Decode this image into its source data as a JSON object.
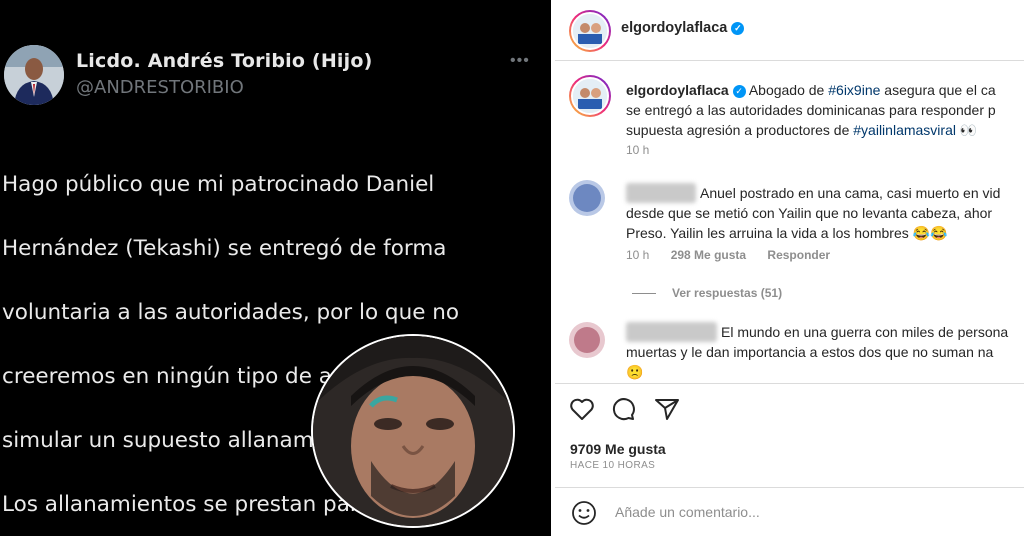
{
  "tweet": {
    "name": "Licdo. Andrés Toribio (Hijo)",
    "handle": "@ANDRESTORIBIO",
    "more_label": "•••",
    "text_lines": [
      "Hago público que mi patrocinado Daniel",
      "Hernández (Tekashi) se entregó de forma",
      "voluntaria a las autoridades, por lo que no",
      "creeremos en ningún tipo de actuación ilícita,",
      "simular un supuesto allanamiento no es bueno.",
      "Los allanamientos se prestan para mucho…"
    ]
  },
  "instagram": {
    "username": "elgordoylaflaca",
    "caption": {
      "username": "elgordoylaflaca",
      "part1": "Abogado de",
      "tag1": "#6ix9ine",
      "part2": "asegura que el ca",
      "line2": "se entregó a las autoridades dominicanas para responder p",
      "line3_prefix": "supuesta agresión a productores de",
      "tag2": "#yailinlamasviral",
      "emoji": "👀",
      "time": "10 h"
    },
    "comments": [
      {
        "lines": [
          "Anuel postrado en una cama, casi muerto en vid",
          "desde que se metió con Yailin que no levanta cabeza, ahor",
          "Preso. Yailin les arruina la vida a los hombres 😂😂"
        ],
        "time": "10 h",
        "likes": "298 Me gusta",
        "reply_label": "Responder",
        "replies_label": "Ver respuestas (51)"
      },
      {
        "lines": [
          "El mundo en una guerra con miles de persona",
          "muertas y le dan importancia a estos dos que no suman na",
          "🙁"
        ]
      }
    ],
    "likes_count": "9709 Me gusta",
    "posted_ago": "HACE 10 HORAS",
    "comment_placeholder": "Añade un comentario..."
  },
  "colors": {
    "verified": "#0095f6",
    "hashtag": "#00376b",
    "muted": "#8e8e8e"
  }
}
